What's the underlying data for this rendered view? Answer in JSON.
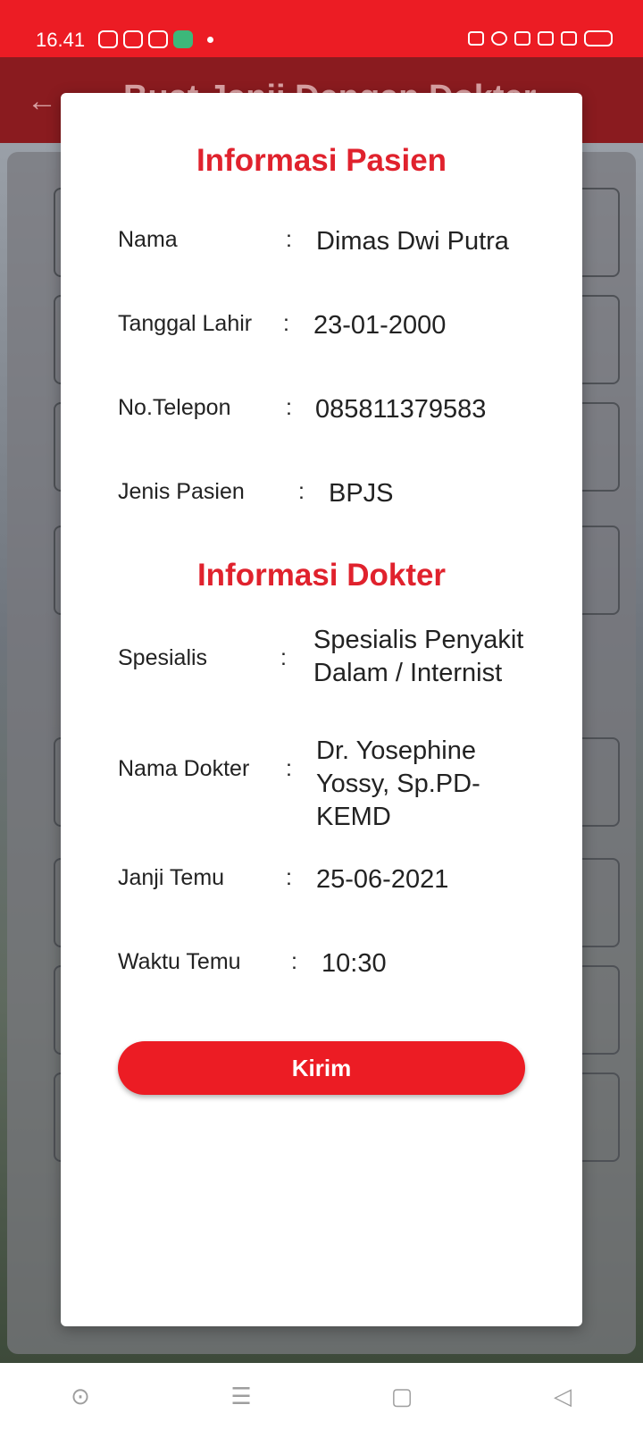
{
  "status_bar": {
    "time": "16.41"
  },
  "app_bar": {
    "back_icon": "arrow-left-icon",
    "title": "Buat Janji Dengan Dokter"
  },
  "dialog": {
    "patient_section_title": "Informasi Pasien",
    "patient_fields": [
      {
        "label": "Nama",
        "value": "Dimas Dwi Putra"
      },
      {
        "label": "Tanggal Lahir",
        "value": "23-01-2000"
      },
      {
        "label": "No.Telepon",
        "value": "085811379583"
      },
      {
        "label": "Jenis Pasien",
        "value": "BPJS"
      }
    ],
    "doctor_section_title": "Informasi Dokter",
    "doctor_fields": [
      {
        "label": "Spesialis",
        "value": "Spesialis Penyakit Dalam / Internist"
      },
      {
        "label": "Nama Dokter",
        "value": "Dr. Yosephine Yossy, Sp.PD-KEMD"
      },
      {
        "label": "Janji Temu",
        "value": "25-06-2021"
      },
      {
        "label": "Waktu Temu",
        "value": "10:30"
      }
    ],
    "colon": ":",
    "submit_label": "Kirim"
  },
  "colors": {
    "accent": "#ec1c24",
    "title_red": "#e0222d"
  },
  "nav_bar": {
    "icons": [
      "circle-dot-icon",
      "menu-icon",
      "square-home-icon",
      "back-triangle-icon"
    ]
  }
}
